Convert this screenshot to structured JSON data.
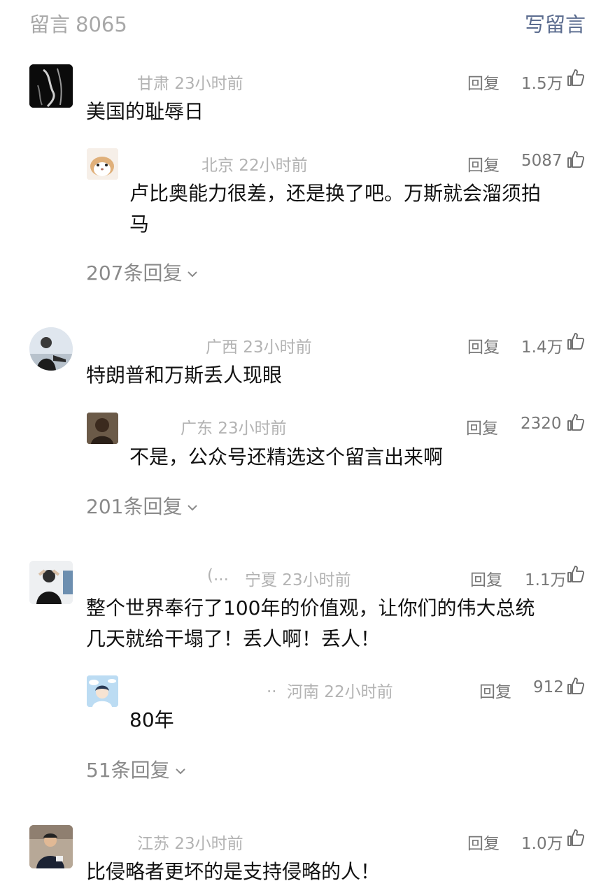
{
  "header": {
    "title": "留言",
    "count": "8065",
    "write_label": "写留言"
  },
  "comments": [
    {
      "meta": "甘肃 23小时前",
      "reply": "回复",
      "likes": "1.5万",
      "text": "美国的耻辱日",
      "sub": {
        "meta": "北京 22小时前",
        "reply": "回复",
        "likes": "5087",
        "line1": "卢比奥能力很差，还是换了吧。万斯就会溜须拍",
        "line2": "马"
      },
      "more": "207条回复"
    },
    {
      "meta": "广西 23小时前",
      "reply": "回复",
      "likes": "1.4万",
      "text": "特朗普和万斯丢人现眼",
      "sub": {
        "meta": "广东 23小时前",
        "reply": "回复",
        "likes": "2320",
        "line1": "不是，公众号还精选这个留言出来啊"
      },
      "more": "201条回复"
    },
    {
      "name": "(...",
      "meta": "宁夏 23小时前",
      "reply": "回复",
      "likes": "1.1万",
      "line1": "整个世界奉行了100年的价值观，让你们的伟大总统",
      "line2": "几天就给干塌了！丢人啊！丢人！",
      "sub": {
        "name": "..",
        "meta": "河南 22小时前",
        "reply": "回复",
        "likes": "912",
        "line1": "80年"
      },
      "more": "51条回复"
    },
    {
      "meta": "江苏 23小时前",
      "reply": "回复",
      "likes": "1.0万",
      "text": "比侵略者更坏的是支持侵略的人！"
    }
  ]
}
